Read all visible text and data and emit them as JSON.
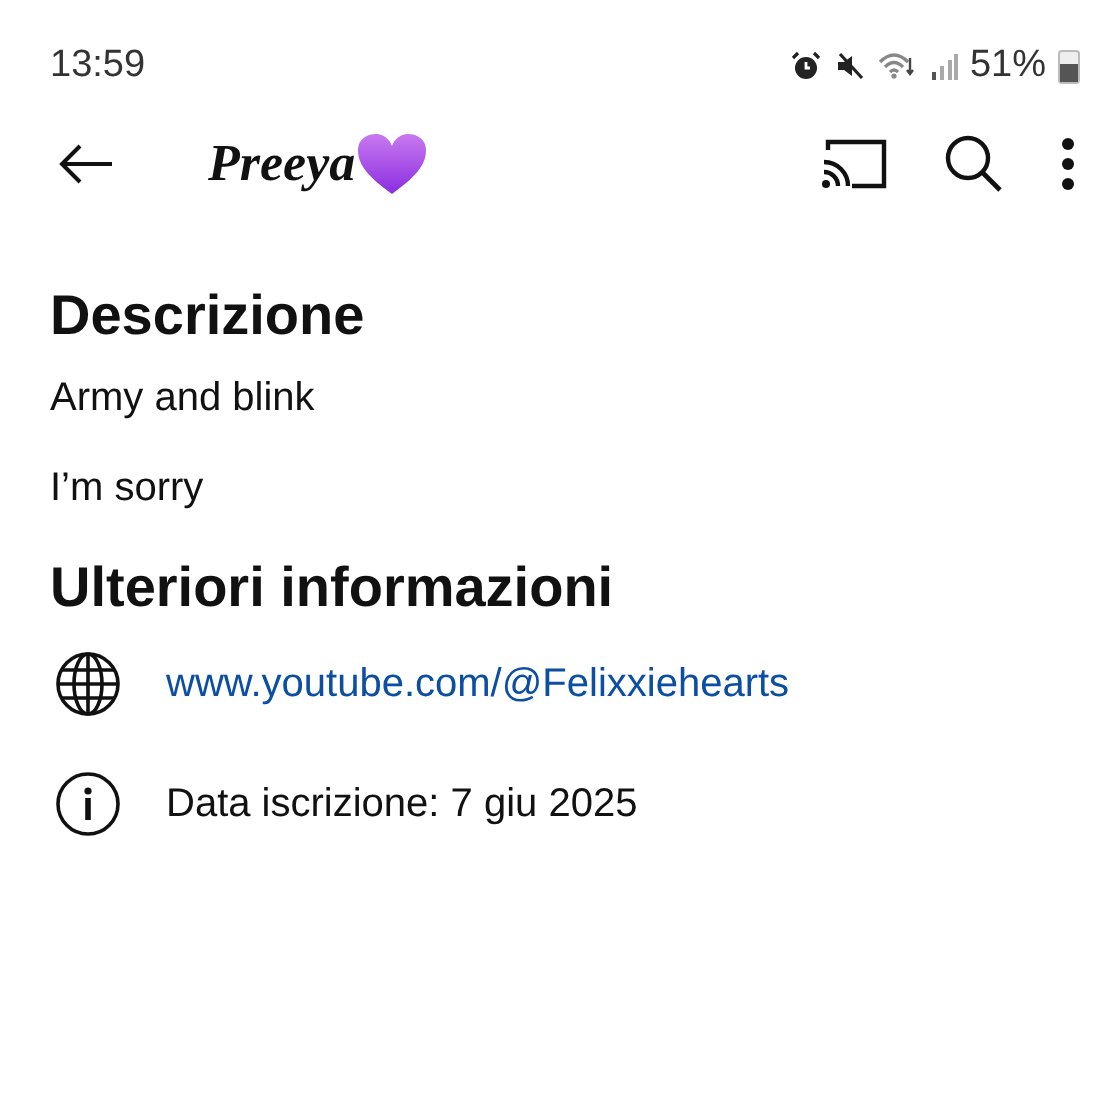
{
  "status_bar": {
    "time": "13:59",
    "battery_text": "51%"
  },
  "toolbar": {
    "title": "Preeya"
  },
  "sections": [
    {
      "heading": "Descrizione",
      "paragraphs": [
        "Army and blink",
        "I’m sorry"
      ]
    },
    {
      "heading": "Ulteriori informazioni",
      "items": [
        {
          "kind": "link",
          "text": "www.youtube.com/@Felixxiehearts"
        },
        {
          "kind": "info",
          "text": "Data iscrizione: 7 giu 2025"
        }
      ]
    }
  ]
}
